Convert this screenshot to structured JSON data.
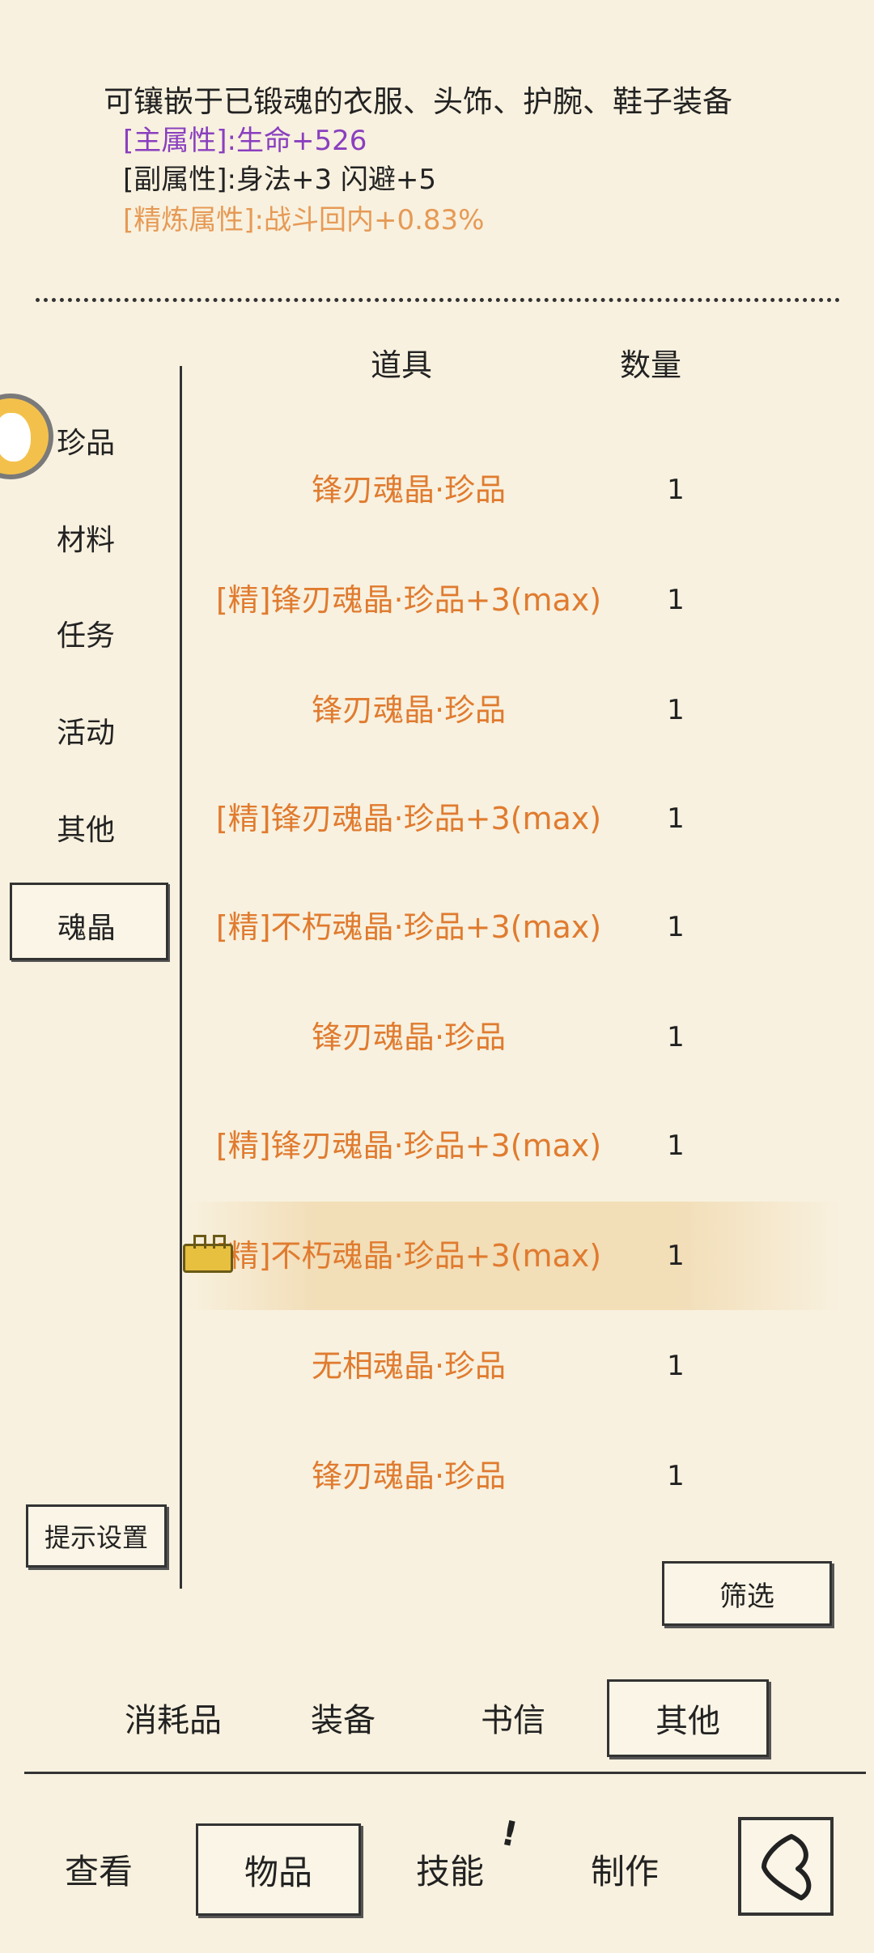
{
  "description": {
    "text": "可镶嵌于已锻魂的衣服、头饰、护腕、鞋子装备",
    "main_attr": "[主属性]:生命+526",
    "sub_attr": "[副属性]:身法+3 闪避+5",
    "refine_attr": "[精炼属性]:战斗回内+0.83%"
  },
  "categories": [
    "珍品",
    "材料",
    "任务",
    "活动",
    "其他",
    "魂晶"
  ],
  "selected_category": "魂晶",
  "table": {
    "headers": {
      "item": "道具",
      "qty": "数量"
    },
    "rows": [
      {
        "name": "锋刃魂晶·珍品",
        "qty": "1"
      },
      {
        "name": "[精]锋刃魂晶·珍品+3(max)",
        "qty": "1"
      },
      {
        "name": "锋刃魂晶·珍品",
        "qty": "1"
      },
      {
        "name": "[精]锋刃魂晶·珍品+3(max)",
        "qty": "1"
      },
      {
        "name": "[精]不朽魂晶·珍品+3(max)",
        "qty": "1"
      },
      {
        "name": "锋刃魂晶·珍品",
        "qty": "1"
      },
      {
        "name": "[精]锋刃魂晶·珍品+3(max)",
        "qty": "1"
      },
      {
        "name": "[精]不朽魂晶·珍品+3(max)",
        "qty": "1"
      },
      {
        "name": "无相魂晶·珍品",
        "qty": "1"
      },
      {
        "name": "锋刃魂晶·珍品",
        "qty": "1"
      }
    ]
  },
  "buttons": {
    "hint_settings": "提示设置",
    "filter": "筛选"
  },
  "sub_tabs": [
    "消耗品",
    "装备",
    "书信",
    "其他"
  ],
  "selected_sub_tab": "其他",
  "nav_tabs": [
    "查看",
    "物品",
    "技能",
    "制作"
  ],
  "selected_nav_tab": "物品",
  "skill_badge": "!",
  "colors": {
    "background": "#f8f1df",
    "item_orange": "#e07b2f",
    "main_attr_purple": "#8a3fbf",
    "refine_orange": "#e69a56"
  }
}
